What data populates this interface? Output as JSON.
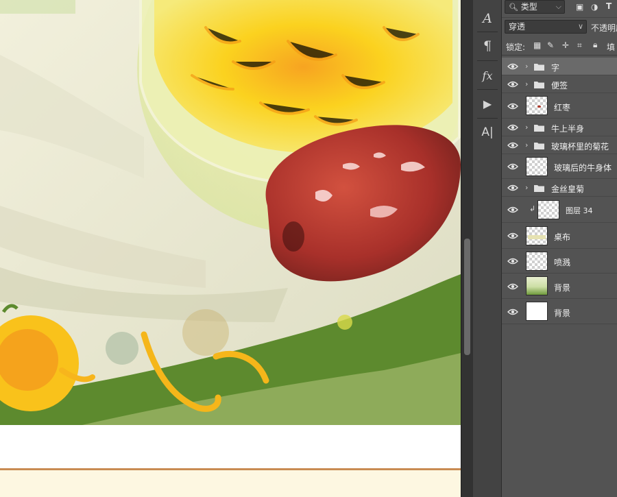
{
  "canvas": {},
  "toolstrip": {
    "tools": [
      {
        "name": "character-panel-icon",
        "glyph": "A"
      },
      {
        "name": "paragraph-panel-icon",
        "glyph": "¶"
      },
      {
        "name": "styles-panel-icon",
        "glyph": "fx"
      },
      {
        "name": "actions-panel-icon",
        "glyph": "▶"
      },
      {
        "name": "glyphs-panel-icon",
        "glyph": "A|"
      }
    ]
  },
  "layers_panel": {
    "filter": {
      "label": "类型"
    },
    "blend_mode": {
      "value": "穿透"
    },
    "opacity": {
      "label": "不透明度"
    },
    "lock": {
      "label": "锁定:",
      "fill_label": "填"
    },
    "layers": [
      {
        "name": "字",
        "type": "group",
        "selected": true
      },
      {
        "name": "便签",
        "type": "group"
      },
      {
        "name": "红枣",
        "type": "pixel",
        "thumb": "jujube"
      },
      {
        "name": "牛上半身",
        "type": "group"
      },
      {
        "name": "玻璃杯里的菊花",
        "type": "group"
      },
      {
        "name": "玻璃后的牛身体",
        "type": "pixel",
        "thumb": "transparent"
      },
      {
        "name": "金丝皇菊",
        "type": "group"
      },
      {
        "name": "图层 34",
        "type": "pixel",
        "clipped": true,
        "thumb": "transparent"
      },
      {
        "name": "桌布",
        "type": "pixel",
        "thumb": "tablecloth"
      },
      {
        "name": "喷溅",
        "type": "pixel",
        "thumb": "transparent"
      },
      {
        "name": "背景",
        "type": "pixel",
        "thumb": "background-art"
      },
      {
        "name": "背景",
        "type": "pixel",
        "thumb": "white"
      }
    ]
  },
  "colors": {
    "panel_bg": "#535353",
    "toolstrip_bg": "#434343",
    "selected_row": "#6a6a6a",
    "doc_rule": "#c98b52",
    "doc_cream": "#fdf7e1"
  }
}
